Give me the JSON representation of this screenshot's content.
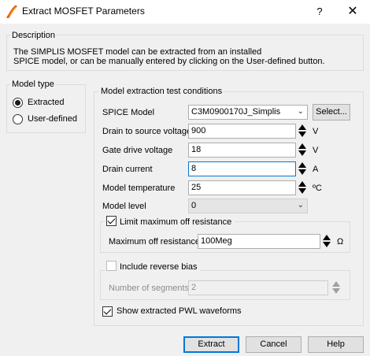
{
  "window": {
    "title": "Extract MOSFET Parameters",
    "help_glyph": "?",
    "close_glyph": "✕"
  },
  "description": {
    "group_title": "Description",
    "line1": "The SIMPLIS MOSFET model can be extracted from an installed",
    "line2": "SPICE model, or can be manually entered by clicking on the User-defined button."
  },
  "model_type": {
    "group_title": "Model type",
    "options": [
      {
        "label": "Extracted",
        "selected": true
      },
      {
        "label": "User-defined",
        "selected": false
      }
    ]
  },
  "conditions": {
    "group_title": "Model extraction test conditions",
    "spice_model": {
      "label": "SPICE Model",
      "value": "C3M0900170J_Simplis",
      "select_label": "Select..."
    },
    "drain_source_voltage": {
      "label": "Drain to source voltage",
      "value": "900",
      "unit": "V"
    },
    "gate_drive_voltage": {
      "label": "Gate drive voltage",
      "value": "18",
      "unit": "V"
    },
    "drain_current": {
      "label": "Drain current",
      "value": "8",
      "unit": "A"
    },
    "model_temperature": {
      "label": "Model temperature",
      "value": "25",
      "unit": "ºC"
    },
    "model_level": {
      "label": "Model level",
      "value": "0"
    }
  },
  "off_resistance": {
    "checkbox_label": "Limit maximum off resistance",
    "checked": true,
    "label": "Maximum off resistance",
    "value": "100Meg",
    "unit": "Ω"
  },
  "reverse_bias": {
    "checkbox_label": "Include reverse bias",
    "checked": false,
    "segments_label": "Number of segments",
    "segments_value": "2"
  },
  "show_pwl": {
    "label": "Show extracted PWL waveforms",
    "checked": true
  },
  "buttons": {
    "extract": "Extract",
    "cancel": "Cancel",
    "help": "Help"
  }
}
